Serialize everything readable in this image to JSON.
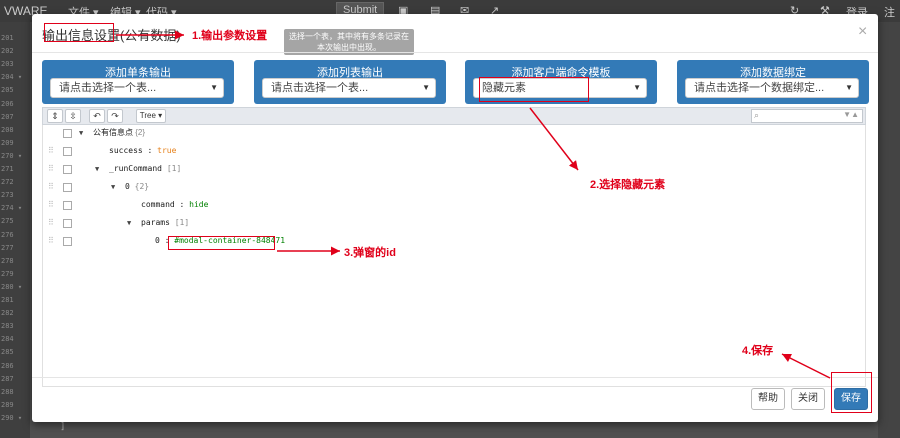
{
  "background": {
    "brand": "VWARE",
    "menus": [
      "文件 ▾",
      "编辑 ▾",
      "代码 ▾"
    ],
    "submit_label": "Submit",
    "right_labels": [
      "登录",
      "注册"
    ],
    "line_numbers": [
      "201",
      "202",
      "203",
      "204 ▾",
      "205",
      "206",
      "207",
      "208",
      "209",
      "270 ▾",
      "271",
      "272",
      "273",
      "274 ▾",
      "275",
      "276",
      "277",
      "278",
      "279",
      "280 ▾",
      "281",
      "282",
      "283",
      "284",
      "285",
      "286",
      "287",
      "288",
      "289",
      "290 ▾"
    ],
    "code_snippet": "]"
  },
  "modal": {
    "title": "输出信息设置(公有数据)",
    "close": "×",
    "tooltip": "选择一个表，其中将有多条记录在本次输出中出现。",
    "panels": [
      {
        "title": "添加单条输出",
        "selected": "请点击选择一个表..."
      },
      {
        "title": "添加列表输出",
        "selected": "请点击选择一个表..."
      },
      {
        "title": "添加客户端命令模板",
        "selected": "隐藏元素"
      },
      {
        "title": "添加数据绑定",
        "selected": "请点击选择一个数据绑定..."
      }
    ],
    "toolbar": {
      "mode": "Tree ▾"
    },
    "tree": [
      {
        "key": "公有信息点",
        "count": "{2}"
      },
      {
        "key": "success",
        "sep": " : ",
        "value": "true"
      },
      {
        "key": "_runCommand",
        "count": "[1]"
      },
      {
        "key": "0",
        "count": "{2}"
      },
      {
        "key": "command",
        "sep": " : ",
        "value": "hide"
      },
      {
        "key": "params",
        "count": "[1]"
      },
      {
        "key": "0",
        "sep": " : ",
        "value": "#modal-container-848471"
      }
    ],
    "buttons": {
      "help": "帮助",
      "close": "关闭",
      "save": "保存"
    }
  },
  "annotations": {
    "step1": "1.输出参数设置",
    "step2": "2.选择隐藏元素",
    "step3": "3.弹窗的id",
    "step4": "4.保存"
  },
  "colors": {
    "primary": "#337ab7",
    "annotation": "#e0001a"
  }
}
